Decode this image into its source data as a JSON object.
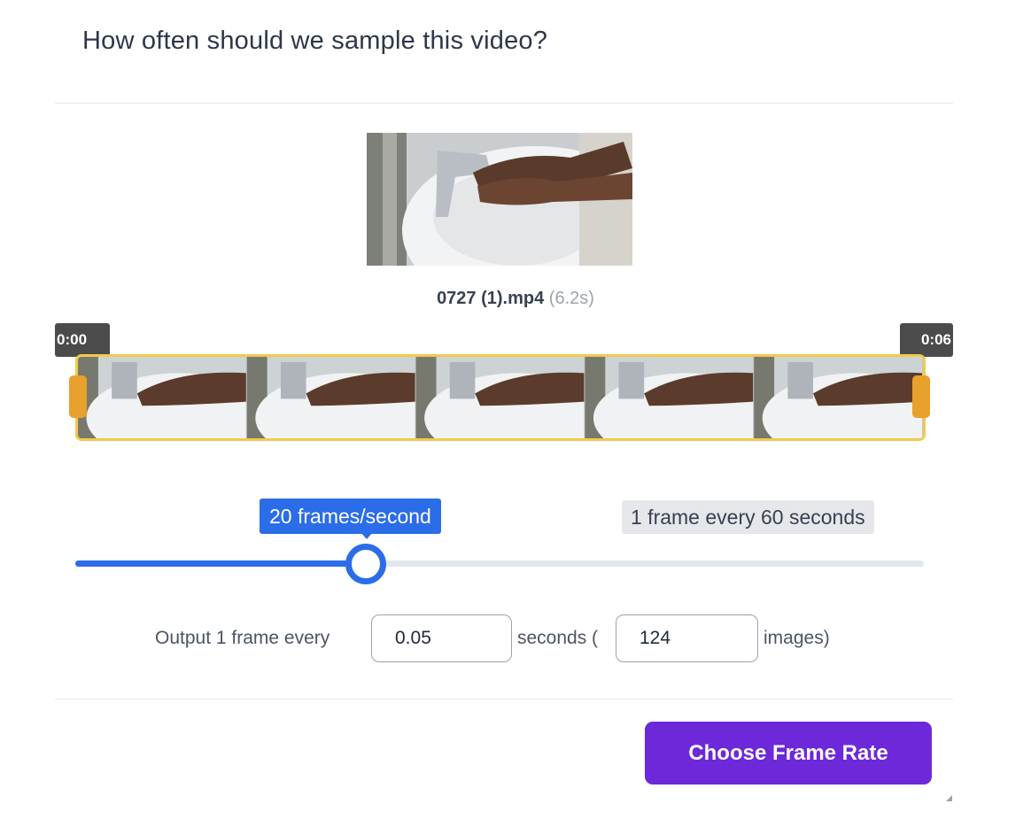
{
  "dialog": {
    "title": "How often should we sample this video?"
  },
  "video": {
    "file_name": "0727 (1).mp4",
    "duration_label": "(6.2s)"
  },
  "timeline": {
    "start_label": "0:00",
    "end_label": "0:06",
    "frame_count": 5
  },
  "slider": {
    "current_label": "20 frames/second",
    "min_label": "1 frame every 60 seconds",
    "value_fraction": 0.34
  },
  "output": {
    "prefix": "Output 1 frame every",
    "seconds_value": "0.05",
    "middle": "seconds (",
    "images_value": "124",
    "suffix": "images)"
  },
  "actions": {
    "confirm_label": "Choose Frame Rate"
  },
  "colors": {
    "accent": "#2b6de8",
    "primary_button": "#6d28d9",
    "trim_border": "#f2c94c",
    "trim_handle": "#e8a12d"
  }
}
